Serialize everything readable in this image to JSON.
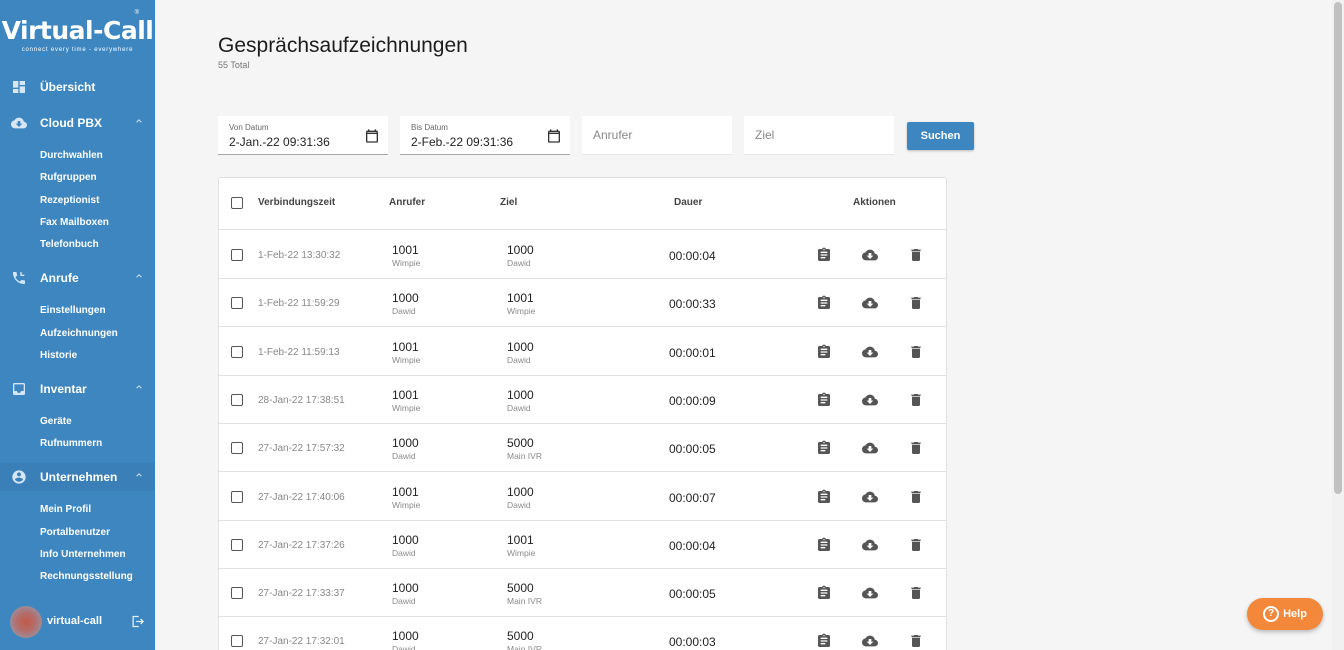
{
  "brand": {
    "name": "Virtual-Call",
    "tagline": "connect every time - everywhere",
    "reg": "®"
  },
  "sidebar": {
    "sections": [
      {
        "label": "Übersicht",
        "icon": "dashboard-icon"
      },
      {
        "label": "Cloud PBX",
        "icon": "cloud-icon",
        "items": [
          "Durchwahlen",
          "Rufgruppen",
          "Rezeptionist",
          "Fax Mailboxen",
          "Telefonbuch"
        ]
      },
      {
        "label": "Anrufe",
        "icon": "phone-forward-icon",
        "items": [
          "Einstellungen",
          "Aufzeichnungen",
          "Historie"
        ]
      },
      {
        "label": "Inventar",
        "icon": "inbox-icon",
        "items": [
          "Geräte",
          "Rufnummern"
        ]
      },
      {
        "label": "Unternehmen",
        "icon": "account-circle-icon",
        "items": [
          "Mein Profil",
          "Portalbenutzer",
          "Info Unternehmen",
          "Rechnungsstellung"
        ]
      }
    ],
    "user": {
      "name": "virtual-call"
    }
  },
  "page": {
    "title": "Gesprächsaufzeichnungen",
    "total": "55 Total"
  },
  "filters": {
    "from_label": "Von Datum",
    "from_value": "2-Jan.-22 09:31:36",
    "to_label": "Bis Datum",
    "to_value": "2-Feb.-22 09:31:36",
    "caller_placeholder": "Anrufer",
    "target_placeholder": "Ziel",
    "search_label": "Suchen"
  },
  "table": {
    "headers": {
      "time": "Verbindungszeit",
      "caller": "Anrufer",
      "target": "Ziel",
      "duration": "Dauer",
      "actions": "Aktionen"
    },
    "rows": [
      {
        "time": "1-Feb-22 13:30:32",
        "caller": "1001",
        "caller_name": "Wimpie",
        "target": "1000",
        "target_name": "Dawid",
        "duration": "00:00:04"
      },
      {
        "time": "1-Feb-22 11:59:29",
        "caller": "1000",
        "caller_name": "Dawid",
        "target": "1001",
        "target_name": "Wimpie",
        "duration": "00:00:33"
      },
      {
        "time": "1-Feb-22 11:59:13",
        "caller": "1001",
        "caller_name": "Wimpie",
        "target": "1000",
        "target_name": "Dawid",
        "duration": "00:00:01"
      },
      {
        "time": "28-Jan-22 17:38:51",
        "caller": "1001",
        "caller_name": "Wimpie",
        "target": "1000",
        "target_name": "Dawid",
        "duration": "00:00:09"
      },
      {
        "time": "27-Jan-22 17:57:32",
        "caller": "1000",
        "caller_name": "Dawid",
        "target": "5000",
        "target_name": "Main IVR",
        "duration": "00:00:05"
      },
      {
        "time": "27-Jan-22 17:40:06",
        "caller": "1001",
        "caller_name": "Wimpie",
        "target": "1000",
        "target_name": "Dawid",
        "duration": "00:00:07"
      },
      {
        "time": "27-Jan-22 17:37:26",
        "caller": "1000",
        "caller_name": "Dawid",
        "target": "1001",
        "target_name": "Wimpie",
        "duration": "00:00:04"
      },
      {
        "time": "27-Jan-22 17:33:37",
        "caller": "1000",
        "caller_name": "Dawid",
        "target": "5000",
        "target_name": "Main IVR",
        "duration": "00:00:05"
      },
      {
        "time": "27-Jan-22 17:32:01",
        "caller": "1000",
        "caller_name": "Dawid",
        "target": "5000",
        "target_name": "Main IVR",
        "duration": "00:00:03"
      }
    ]
  },
  "help": {
    "label": "Help",
    "mark": "?"
  },
  "colors": {
    "sidebar": "#3d86c0",
    "accent": "#3d86c0",
    "help": "#f3883a"
  }
}
